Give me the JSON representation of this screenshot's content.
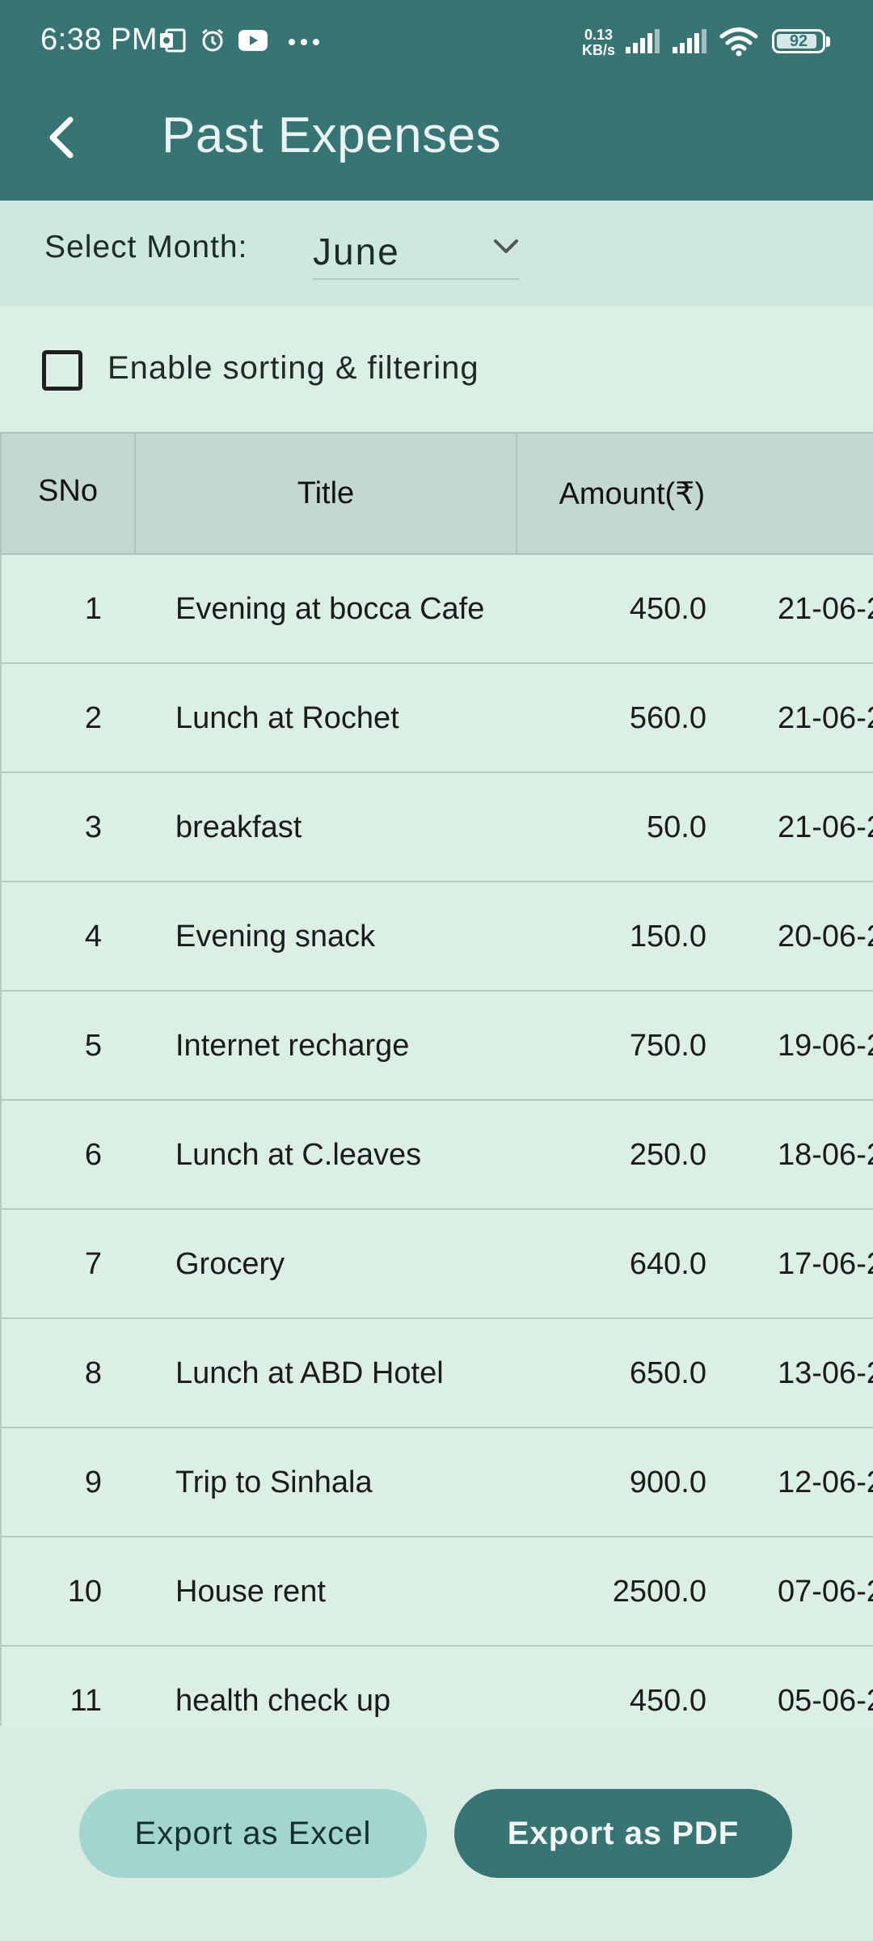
{
  "status_bar": {
    "time": "6:38 PM",
    "speed_value": "0.13",
    "speed_unit": "KB/s",
    "battery": "92",
    "icons": [
      "outlook-icon",
      "alarm-icon",
      "youtube-icon",
      "more-dots-icon",
      "signal-icon",
      "signal-icon",
      "wifi-icon",
      "battery-icon"
    ]
  },
  "app_bar": {
    "title": "Past Expenses",
    "back_icon": "back-arrow-icon"
  },
  "month_selector": {
    "label": "Select Month:",
    "selected": "June"
  },
  "sorting": {
    "label": "Enable sorting & filtering",
    "checked": false
  },
  "table": {
    "headers": {
      "sno": "SNo",
      "title": "Title",
      "amount": "Amount(₹)"
    },
    "rows": [
      {
        "sno": "1",
        "title": "Evening at bocca Cafe",
        "amount": "450.0",
        "date": "21-06-2"
      },
      {
        "sno": "2",
        "title": "Lunch at Rochet",
        "amount": "560.0",
        "date": "21-06-2"
      },
      {
        "sno": "3",
        "title": "breakfast",
        "amount": "50.0",
        "date": "21-06-2"
      },
      {
        "sno": "4",
        "title": "Evening snack",
        "amount": "150.0",
        "date": "20-06-2"
      },
      {
        "sno": "5",
        "title": "Internet recharge",
        "amount": "750.0",
        "date": "19-06-2"
      },
      {
        "sno": "6",
        "title": "Lunch at C.leaves",
        "amount": "250.0",
        "date": "18-06-2"
      },
      {
        "sno": "7",
        "title": "Grocery",
        "amount": "640.0",
        "date": "17-06-2"
      },
      {
        "sno": "8",
        "title": "Lunch at ABD Hotel",
        "amount": "650.0",
        "date": "13-06-2"
      },
      {
        "sno": "9",
        "title": "Trip to Sinhala",
        "amount": "900.0",
        "date": "12-06-2"
      },
      {
        "sno": "10",
        "title": "House rent",
        "amount": "2500.0",
        "date": "07-06-2"
      },
      {
        "sno": "11",
        "title": "health check up",
        "amount": "450.0",
        "date": "05-06-2"
      }
    ]
  },
  "actions": {
    "export_excel": "Export as Excel",
    "export_pdf": "Export as PDF"
  },
  "colors": {
    "app_bar": "#377575",
    "row_background": "#dcefe4",
    "header_background": "#c3d8ce",
    "excel_button": "#a3d5cf",
    "pdf_button": "#377575"
  }
}
